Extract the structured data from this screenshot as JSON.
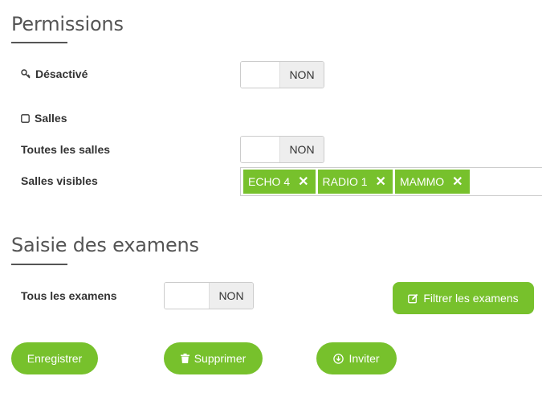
{
  "permissions": {
    "title": "Permissions",
    "desactive": {
      "label": "Désactivé",
      "toggle_text": "NON",
      "icon": "key-icon"
    },
    "salles": {
      "label": "Salles",
      "icon": "square-icon"
    },
    "toutes_salles": {
      "label": "Toutes les salles",
      "toggle_text": "NON"
    },
    "salles_visibles": {
      "label": "Salles visibles",
      "tags": [
        {
          "text": "ECHO 4",
          "remove": "✕"
        },
        {
          "text": "RADIO 1",
          "remove": "✕"
        },
        {
          "text": "MAMMO",
          "remove": "✕"
        }
      ]
    }
  },
  "exams": {
    "title": "Saisie des examens",
    "tous_examens": {
      "label": "Tous les examens",
      "toggle_text": "NON"
    },
    "filter_button": {
      "label": "Filtrer les examens",
      "icon": "edit-icon"
    }
  },
  "actions": {
    "save": {
      "label": "Enregistrer"
    },
    "delete": {
      "label": "Supprimer",
      "icon": "trash-icon"
    },
    "invite": {
      "label": "Inviter",
      "icon": "download-circle-icon"
    }
  },
  "colors": {
    "accent": "#77c12c",
    "title": "#555555"
  }
}
